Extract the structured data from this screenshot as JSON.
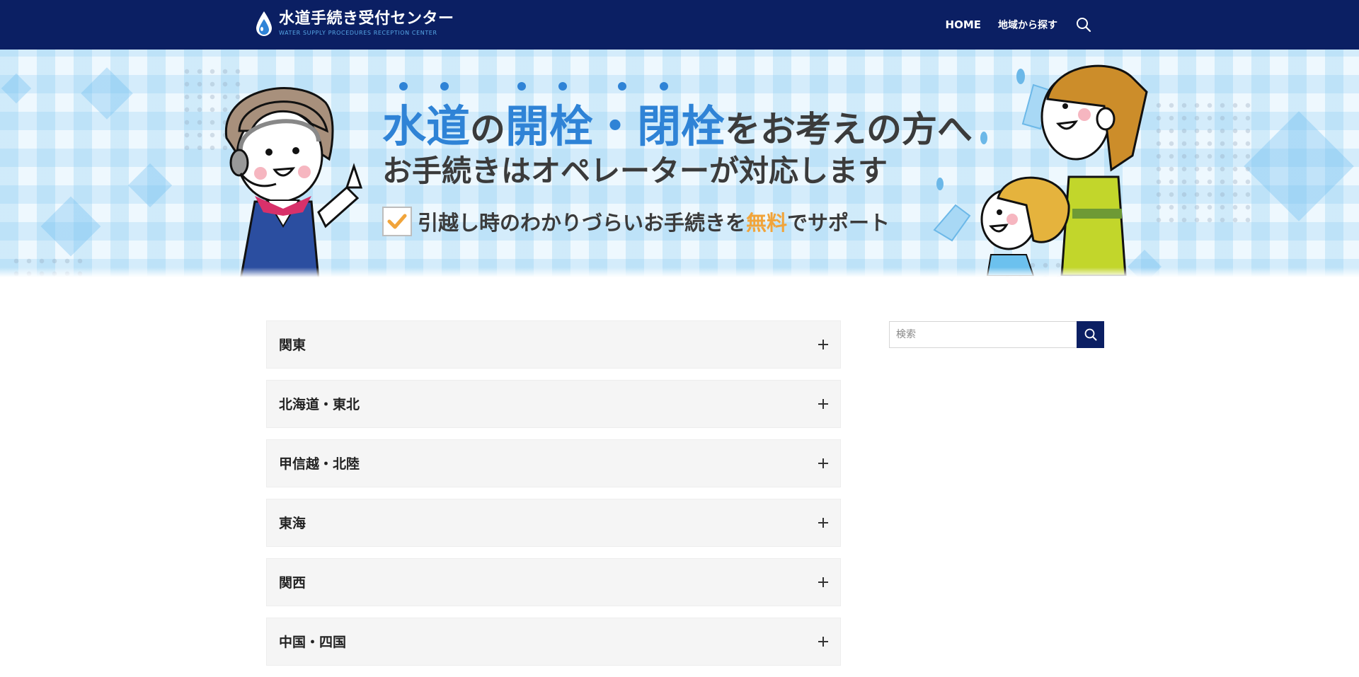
{
  "header": {
    "logo_title": "水道手続き受付センター",
    "logo_subtitle": "WATER SUPPLY PROCEDURES RECEPTION CENTER",
    "nav": {
      "home": "HOME",
      "by_region": "地域から探す"
    },
    "icons": {
      "logo": "water-drop-icon",
      "search": "search-icon"
    },
    "background_color": "#0b1f63"
  },
  "hero": {
    "title_parts": {
      "p1": "水道",
      "p2": "の",
      "p3": "開栓",
      "p4": "・",
      "p5": "閉栓",
      "p6": "をお考えの方へ"
    },
    "subtitle": "お手続きはオペレーターが対応します",
    "check_text_parts": {
      "before": "引越し時のわかりづらいお手続きを",
      "highlight": "無料",
      "after": "でサポート"
    },
    "colors": {
      "accent_blue": "#2f83d6",
      "accent_orange": "#f1a43a",
      "text": "#3b3b3b"
    }
  },
  "regions": [
    {
      "label": "関東"
    },
    {
      "label": "北海道・東北"
    },
    {
      "label": "甲信越・北陸"
    },
    {
      "label": "東海"
    },
    {
      "label": "関西"
    },
    {
      "label": "中国・四国"
    }
  ],
  "sidebar": {
    "search_placeholder": "検索",
    "search_value": ""
  }
}
